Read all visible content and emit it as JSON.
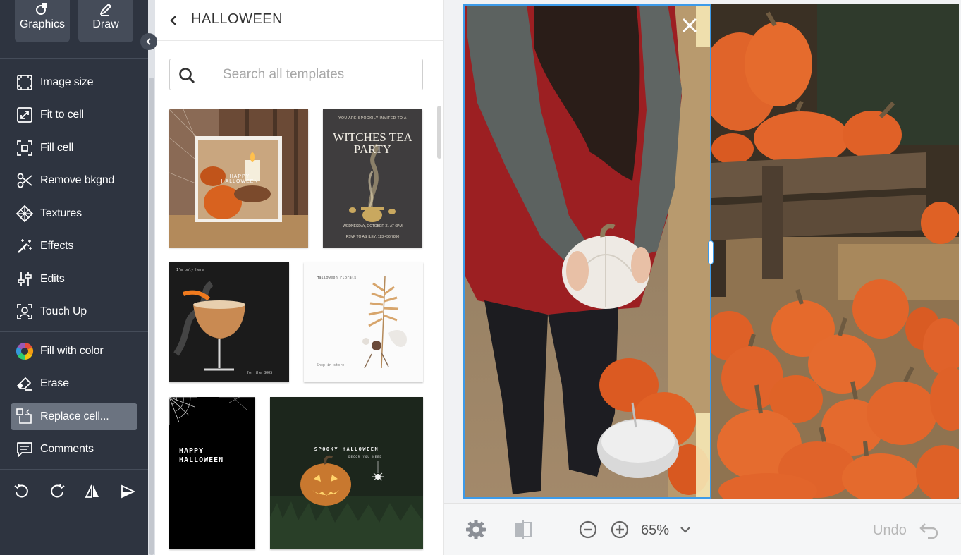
{
  "sidebar": {
    "top_tools": [
      {
        "label": "Graphics",
        "icon": "graphics-icon"
      },
      {
        "label": "Draw",
        "icon": "pen-icon"
      }
    ],
    "items": [
      {
        "label": "Image size",
        "icon": "image-size-icon"
      },
      {
        "label": "Fit to cell",
        "icon": "fit-to-cell-icon"
      },
      {
        "label": "Fill cell",
        "icon": "fill-cell-icon"
      },
      {
        "label": "Remove bkgnd",
        "icon": "scissors-icon"
      },
      {
        "label": "Textures",
        "icon": "textures-icon"
      },
      {
        "label": "Effects",
        "icon": "magic-wand-icon"
      },
      {
        "label": "Edits",
        "icon": "sliders-icon"
      },
      {
        "label": "Touch Up",
        "icon": "face-icon"
      },
      {
        "label": "Fill with color",
        "icon": "color-wheel-icon"
      },
      {
        "label": "Erase",
        "icon": "eraser-icon"
      },
      {
        "label": "Replace cell...",
        "icon": "replace-icon",
        "active": true
      },
      {
        "label": "Comments",
        "icon": "comment-icon"
      }
    ],
    "bottom_icons": [
      "rotate-left-icon",
      "rotate-right-icon",
      "flip-horizontal-icon",
      "flip-vertical-icon"
    ]
  },
  "panel": {
    "title": "HALLOWEEN",
    "search": {
      "placeholder": "Search all templates",
      "value": ""
    },
    "templates": [
      {
        "name": "happy-halloween-candle",
        "text": "HAPPY HALLOWEEN"
      },
      {
        "name": "witches-tea-party",
        "top_text": "YOU ARE SPOOKILY INVITED TO A",
        "title": "WITCHES TEA PARTY",
        "date_text": "WEDNESDAY, OCTOBER 31 AT 6PM",
        "rsvp_text": "RSVP TO ASHLEY: 123.456.7890"
      },
      {
        "name": "cocktail",
        "top_text": "I'm only here",
        "bottom_text": "for the BOOS"
      },
      {
        "name": "halloween-florals",
        "title": "Halloween Florals",
        "bottom_text": "Shop in store"
      },
      {
        "name": "happy-halloween-web",
        "title": "HAPPY HALLOWEEN"
      },
      {
        "name": "spooky-halloween",
        "title": "SPOOKY HALLOWEEN",
        "subtitle": "DECOR YOU NEED"
      }
    ]
  },
  "toolbar": {
    "zoom": "65%",
    "undo_label": "Undo"
  },
  "colors": {
    "sidebar_bg": "#2e3440",
    "selection": "#3d9be9",
    "pumpkin": "#e3642a"
  }
}
